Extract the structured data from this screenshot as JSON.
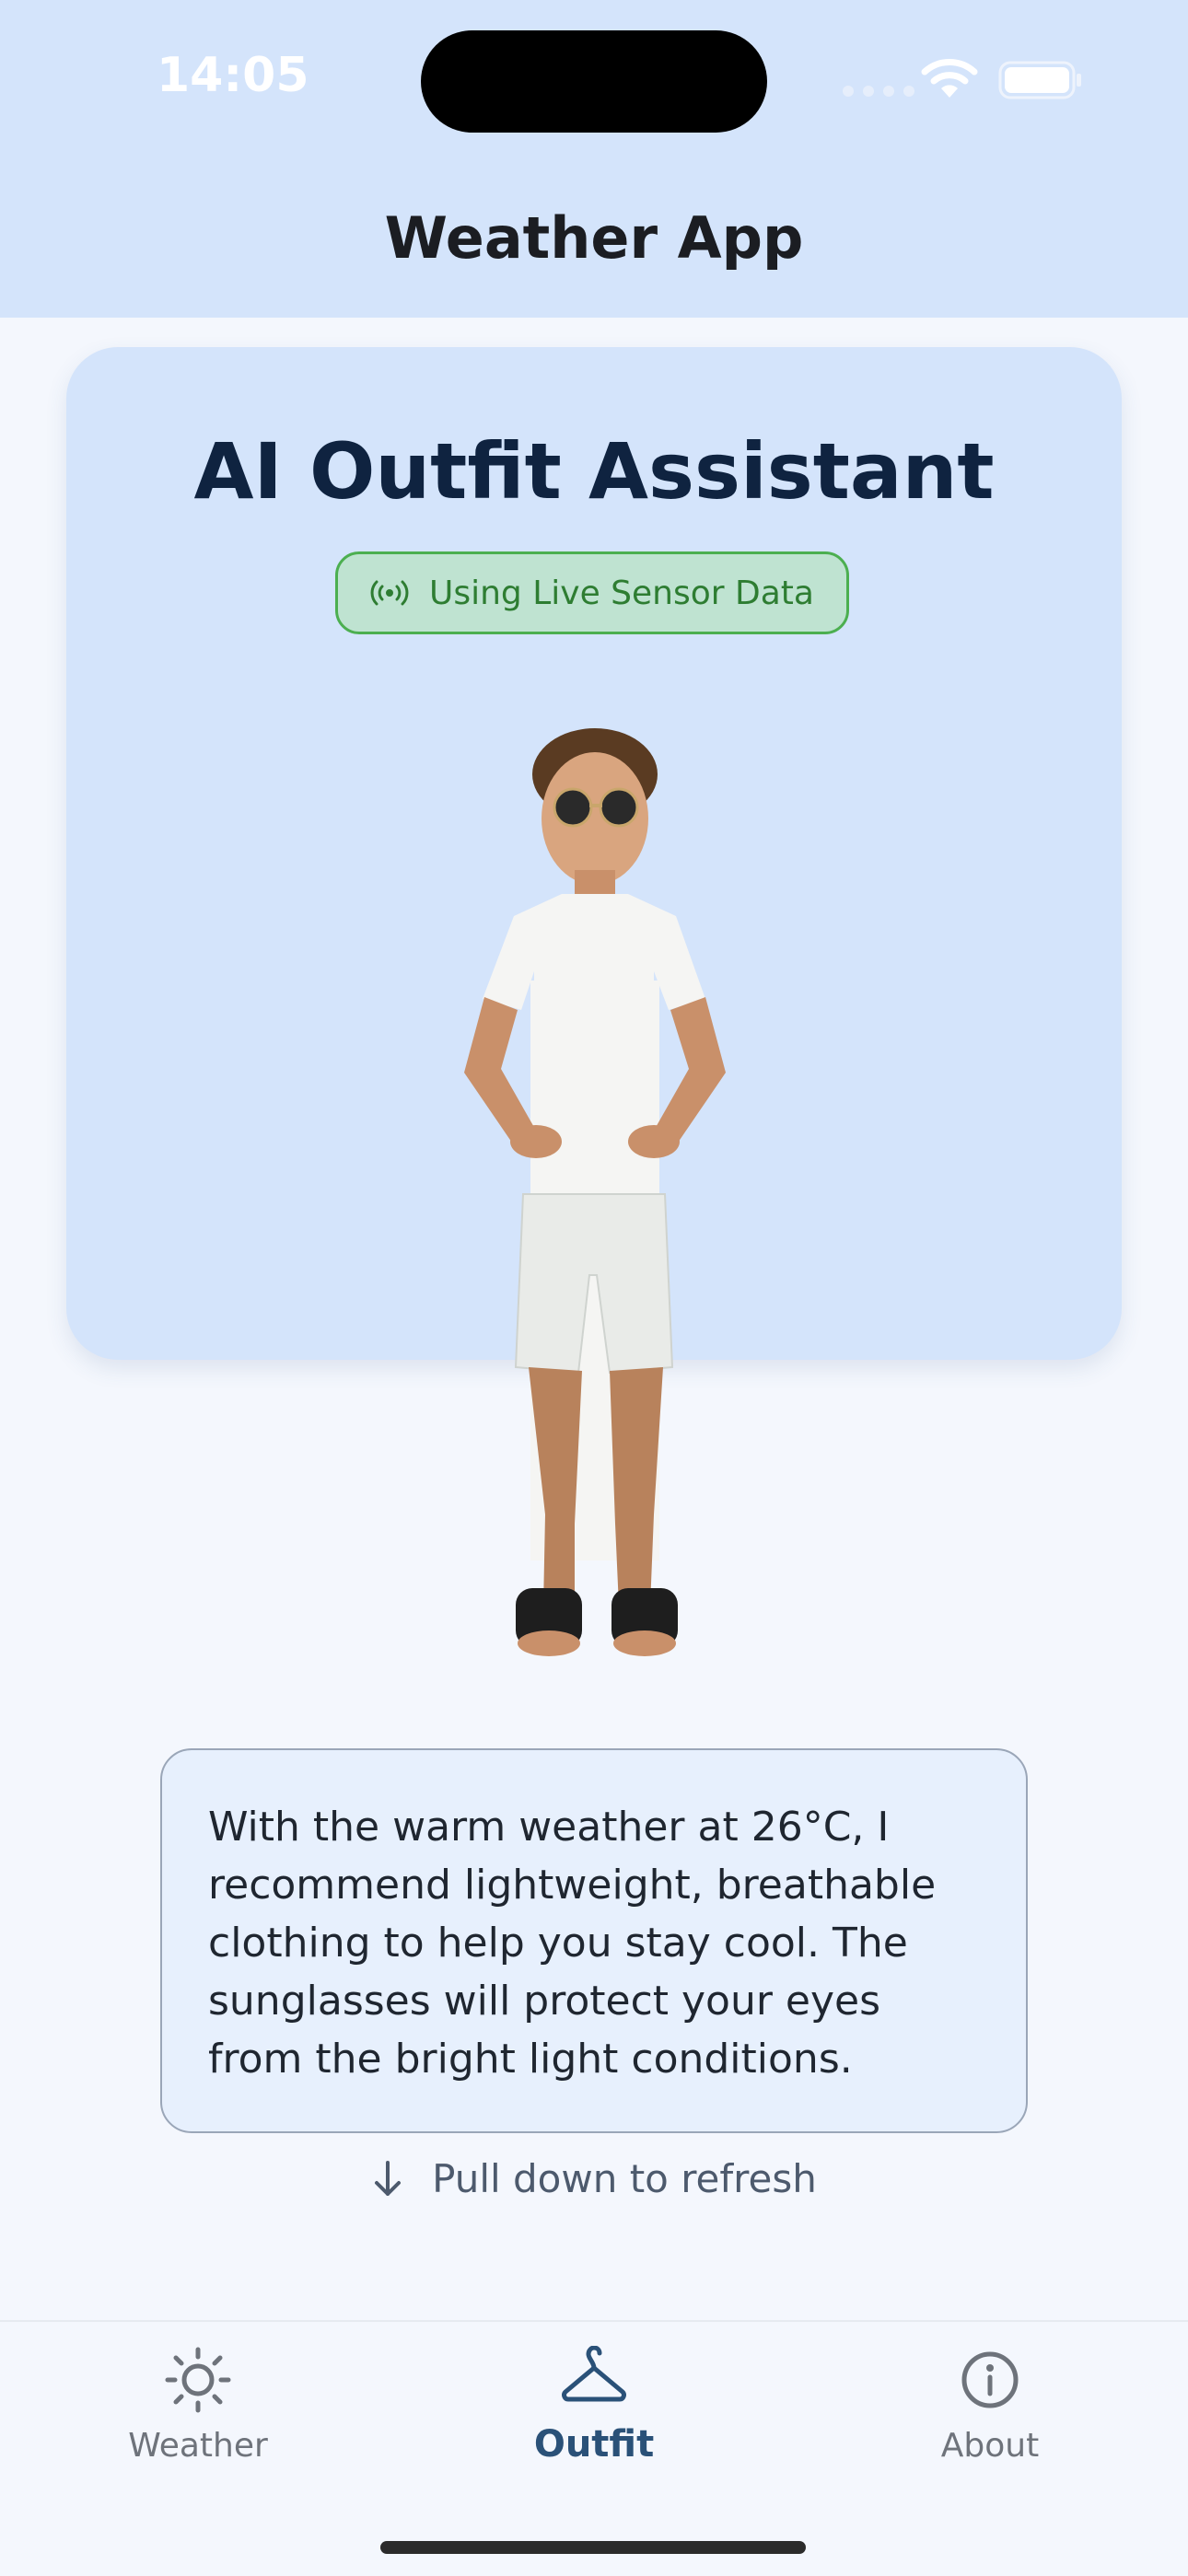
{
  "status_bar": {
    "time": "14:05"
  },
  "header": {
    "title": "Weather App"
  },
  "card": {
    "title": "AI Outfit Assistant",
    "badge": {
      "icon": "sensor-broadcast-icon",
      "label": "Using Live Sensor Data",
      "color": "#2e7d32"
    },
    "image": "outfit-person-figure",
    "recommendation": "With the warm weather at 26°C, I recommend lightweight, breathable clothing to help you stay cool. The sunglasses will protect your eyes from the bright light conditions.",
    "refresh": {
      "icon": "arrow-down-icon",
      "label": "Pull down to refresh"
    }
  },
  "tab_bar": {
    "items": [
      {
        "icon": "sun-icon",
        "label": "Weather",
        "active": false
      },
      {
        "icon": "hanger-icon",
        "label": "Outfit",
        "active": true
      },
      {
        "icon": "info-icon",
        "label": "About",
        "active": false
      }
    ],
    "active_color": "#2a5178"
  },
  "colors": {
    "header_bg": "#d4e4fb",
    "card_bg": "#d4e4fb",
    "page_bg": "#f4f7fd"
  }
}
